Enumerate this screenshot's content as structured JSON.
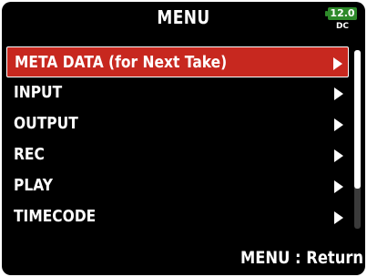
{
  "header": {
    "title": "MENU",
    "battery": {
      "level": "12.0",
      "source": "DC",
      "color": "#2e8a2a",
      "icon": "battery-icon"
    }
  },
  "menu": {
    "selected_index": 0,
    "highlight_color": "#c7281f",
    "items": [
      {
        "label": "META DATA (for Next Take)",
        "icon": "arrow-right-icon"
      },
      {
        "label": "INPUT",
        "icon": "arrow-right-icon"
      },
      {
        "label": "OUTPUT",
        "icon": "arrow-right-icon"
      },
      {
        "label": "REC",
        "icon": "arrow-right-icon"
      },
      {
        "label": "PLAY",
        "icon": "arrow-right-icon"
      },
      {
        "label": "TIMECODE",
        "icon": "arrow-right-icon"
      }
    ]
  },
  "scrollbar": {
    "position": 0.0
  },
  "footer": {
    "hint": "MENU : Return"
  }
}
